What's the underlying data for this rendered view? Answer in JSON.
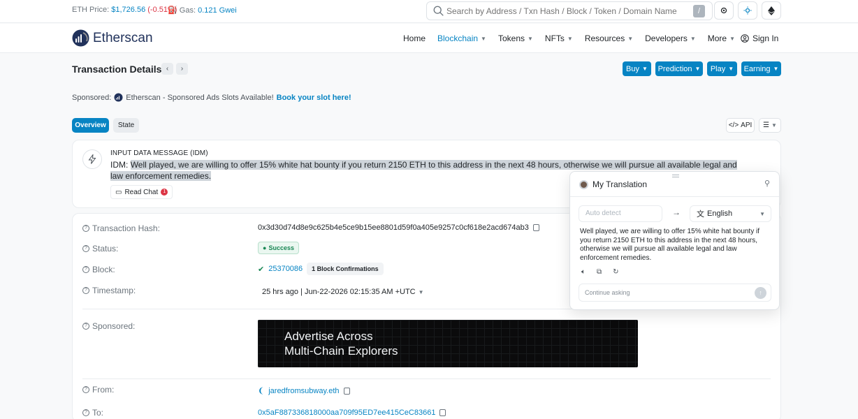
{
  "topbar": {
    "eth_label": "ETH Price:",
    "eth_price": "$1,726.56",
    "eth_change": "(-0.51%)",
    "gas_label": "Gas:",
    "gas_value": "0.121 Gwei",
    "search_placeholder": "Search by Address / Txn Hash / Block / Token / Domain Name",
    "search_shortcut": "/"
  },
  "nav": {
    "brand": "Etherscan",
    "items": [
      {
        "label": "Home",
        "dropdown": false,
        "active": false
      },
      {
        "label": "Blockchain",
        "dropdown": true,
        "active": true
      },
      {
        "label": "Tokens",
        "dropdown": true,
        "active": false
      },
      {
        "label": "NFTs",
        "dropdown": true,
        "active": false
      },
      {
        "label": "Resources",
        "dropdown": true,
        "active": false
      },
      {
        "label": "Developers",
        "dropdown": true,
        "active": false
      },
      {
        "label": "More",
        "dropdown": true,
        "active": false
      }
    ],
    "signin": "Sign In"
  },
  "header": {
    "title": "Transaction Details",
    "buttons": [
      "Buy",
      "Prediction",
      "Play",
      "Earning"
    ]
  },
  "sponsored": {
    "label": "Sponsored:",
    "text": "Etherscan - Sponsored Ads Slots Available!",
    "link": "Book your slot here!"
  },
  "tabs": {
    "overview": "Overview",
    "state": "State",
    "api": "API"
  },
  "idm": {
    "title": "INPUT DATA MESSAGE (IDM)",
    "prefix": "IDM:",
    "message": "Well played, we are willing to offer 15% white hat bounty if you return 2150 ETH to this address in the next 48 hours, otherwise we will pursue all available legal and law enforcement remedies.",
    "read_chat": "Read Chat",
    "badge": "1"
  },
  "details": {
    "tx_hash_label": "Transaction Hash:",
    "tx_hash": "0x3d30d74d8e9c625b4e5ce9b15ee8801d59f0a405e9257c0cf618e2acd674ab3",
    "status_label": "Status:",
    "status": "Success",
    "block_label": "Block:",
    "block": "25370086",
    "block_confirmations": "1 Block Confirmations",
    "timestamp_label": "Timestamp:",
    "timestamp": "25 hrs ago | Jun-22-2026 02:15:35 AM +UTC",
    "sponsored_label": "Sponsored:",
    "ad_line1": "Advertise Across",
    "ad_line2": "Multi-Chain Explorers",
    "from_label": "From:",
    "from": "jaredfromsubway.eth",
    "to_label": "To:",
    "to": "0x5aF887336818000aa709f95ED7ee415CeC83661"
  },
  "translation": {
    "title": "My Translation",
    "source": "Auto detect",
    "target": "English",
    "output": "Well played, we are willing to offer 15% white hat bounty if you return 2150 ETH to this address in the next 48 hours, otherwise we will pursue all available legal and law enforcement remedies.",
    "input_placeholder": "Continue asking"
  },
  "colors": {
    "accent": "#0784c3",
    "brand_dark": "#21325b",
    "success": "#198754",
    "danger": "#dc3545"
  }
}
